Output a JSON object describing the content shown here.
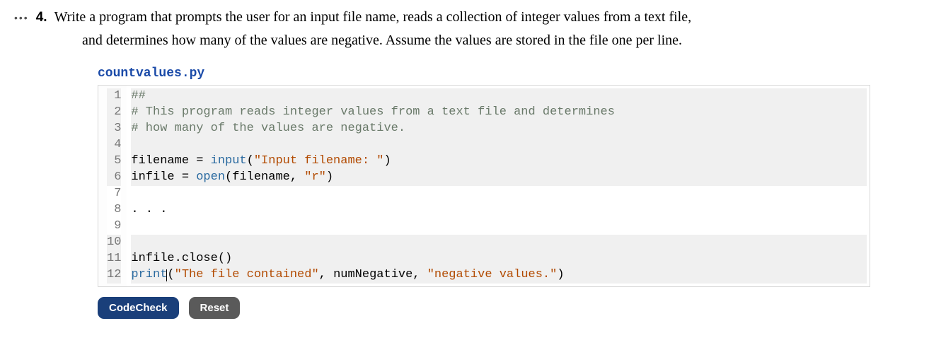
{
  "problem": {
    "dots": "•••",
    "number": "4.",
    "text_line1": "Write a program that prompts the user for an input file name, reads a collection of integer values from a text file,",
    "text_line2": "and determines how many of the values are negative. Assume the values are stored in the file one per line."
  },
  "filename": "countvalues.py",
  "code": {
    "line_numbers": [
      "1",
      "2",
      "3",
      "4",
      "5",
      "6",
      "7",
      "8",
      "9",
      "10",
      "11",
      "12"
    ],
    "lines": [
      {
        "editable": false,
        "tokens": [
          {
            "t": "##",
            "c": "comment"
          }
        ]
      },
      {
        "editable": false,
        "tokens": [
          {
            "t": "# This program reads integer values from a text file and determines",
            "c": "comment"
          }
        ]
      },
      {
        "editable": false,
        "tokens": [
          {
            "t": "# how many of the values are negative.",
            "c": "comment"
          }
        ]
      },
      {
        "editable": false,
        "tokens": []
      },
      {
        "editable": false,
        "tokens": [
          {
            "t": "filename = ",
            "c": "plain"
          },
          {
            "t": "input",
            "c": "func"
          },
          {
            "t": "(",
            "c": "plain"
          },
          {
            "t": "\"Input filename: \"",
            "c": "string"
          },
          {
            "t": ")",
            "c": "plain"
          }
        ]
      },
      {
        "editable": false,
        "tokens": [
          {
            "t": "infile = ",
            "c": "plain"
          },
          {
            "t": "open",
            "c": "func"
          },
          {
            "t": "(filename, ",
            "c": "plain"
          },
          {
            "t": "\"r\"",
            "c": "string"
          },
          {
            "t": ")",
            "c": "plain"
          }
        ]
      },
      {
        "editable": true,
        "tokens": []
      },
      {
        "editable": true,
        "tokens": [
          {
            "t": ". . .",
            "c": "plain"
          }
        ]
      },
      {
        "editable": true,
        "tokens": []
      },
      {
        "editable": false,
        "tokens": []
      },
      {
        "editable": false,
        "tokens": [
          {
            "t": "infile.close()",
            "c": "plain"
          }
        ]
      },
      {
        "editable": false,
        "cursor_at": 5,
        "tokens": [
          {
            "t": "print",
            "c": "func"
          },
          {
            "t": "(",
            "c": "plain"
          },
          {
            "t": "\"The file contained\"",
            "c": "string"
          },
          {
            "t": ", numNegative, ",
            "c": "plain"
          },
          {
            "t": "\"negative values.\"",
            "c": "string"
          },
          {
            "t": ")",
            "c": "plain"
          }
        ]
      }
    ]
  },
  "buttons": {
    "codecheck": "CodeCheck",
    "reset": "Reset"
  }
}
